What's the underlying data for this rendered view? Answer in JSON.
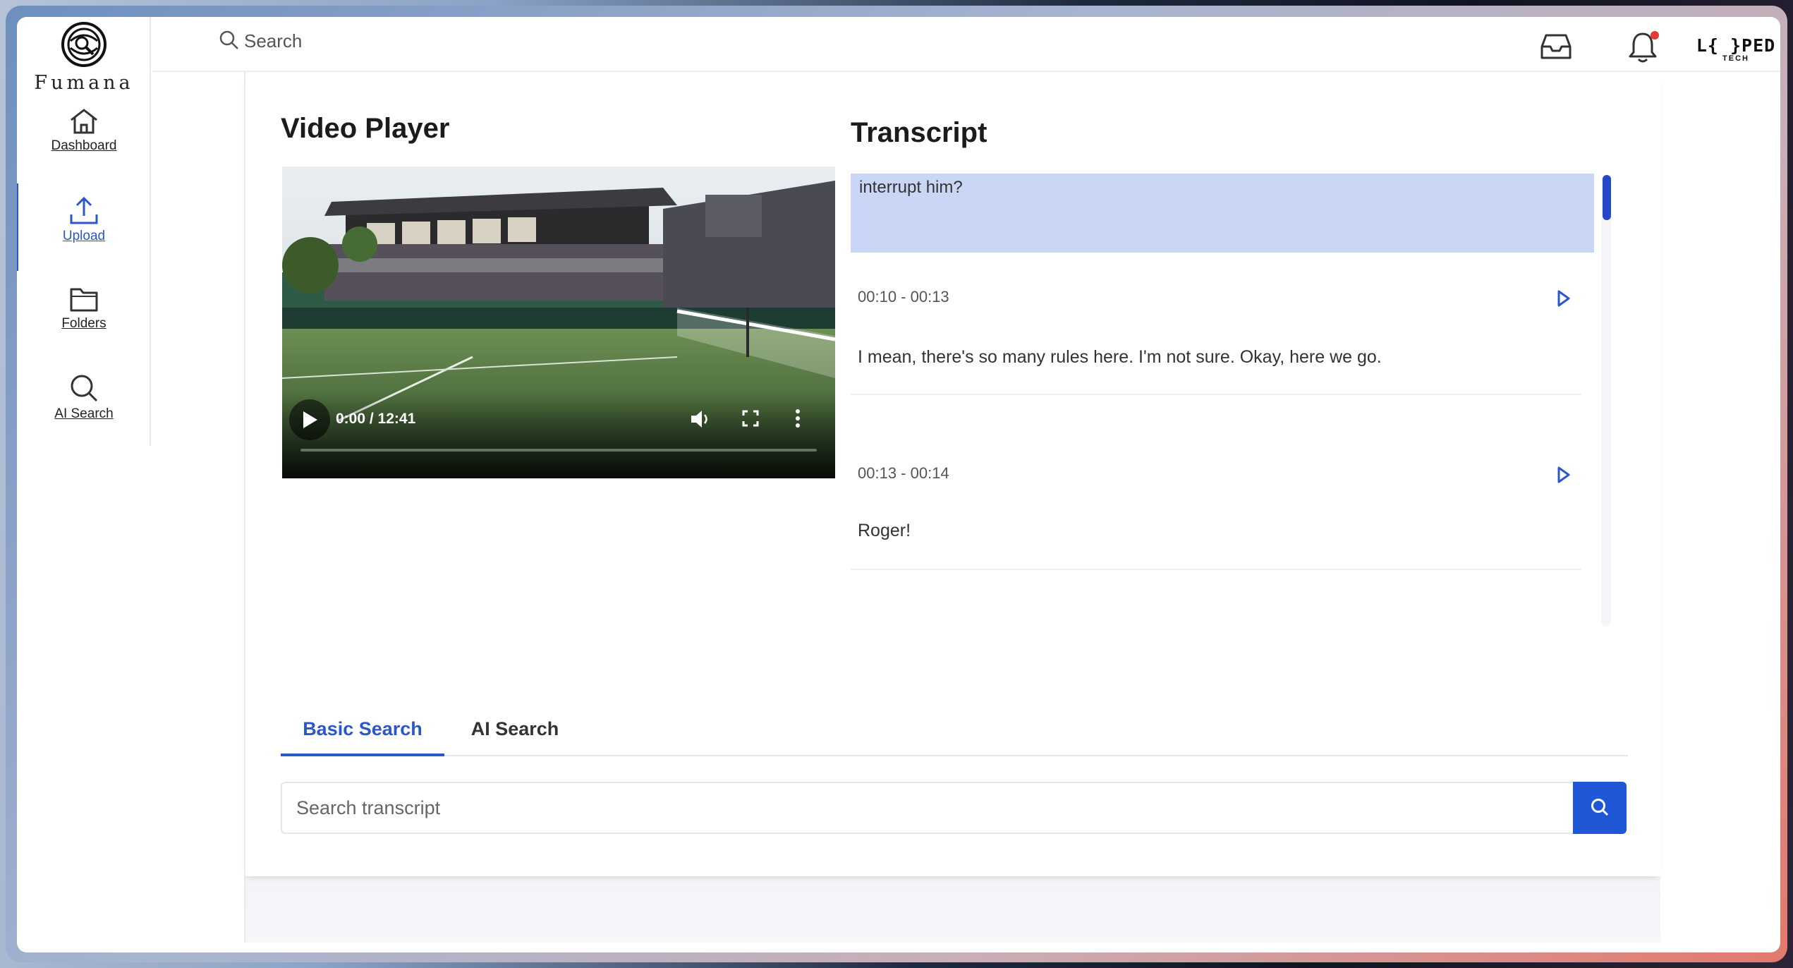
{
  "app": {
    "logo_text": "Fumana",
    "brand_main": "L{ }PED",
    "brand_sub": "TECH"
  },
  "sidebar": {
    "items": [
      {
        "label": "Dashboard",
        "icon": "home-icon",
        "active": false
      },
      {
        "label": "Upload",
        "icon": "upload-icon",
        "active": true
      },
      {
        "label": "Folders",
        "icon": "folder-icon",
        "active": false
      },
      {
        "label": "AI Search",
        "icon": "search-icon",
        "active": false
      }
    ]
  },
  "topbar": {
    "search_placeholder": "Search"
  },
  "video_player": {
    "title": "Video Player",
    "time": "0:00 / 12:41",
    "progress": 0.0
  },
  "transcript": {
    "title": "Transcript",
    "highlighted_text": "interrupt him?",
    "segments": [
      {
        "time": "00:10 - 00:13",
        "text": "I mean, there's so many rules here. I'm not sure. Okay, here we go."
      },
      {
        "time": "00:13 - 00:14",
        "text": "Roger!"
      }
    ]
  },
  "tabs": [
    {
      "label": "Basic Search",
      "active": true
    },
    {
      "label": "AI Search",
      "active": false
    }
  ],
  "transcript_search": {
    "placeholder": "Search transcript"
  },
  "colors": {
    "accent": "#2c57c8",
    "highlight": "#c9d6f5",
    "button": "#2057d6",
    "notification": "#e53935"
  }
}
